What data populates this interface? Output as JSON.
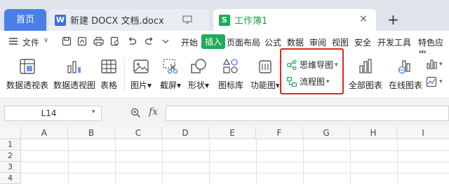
{
  "tabs": {
    "home": "首页",
    "doc": "新建 DOCX 文档.docx",
    "doc_logo": "W",
    "sheet": "工作簿1",
    "sheet_logo": "S",
    "close": "×",
    "new_tab": "+"
  },
  "menu": {
    "file": "文件",
    "file_chev": "∨",
    "items": [
      "开始",
      "插入",
      "页面布局",
      "公式",
      "数据",
      "审阅",
      "视图",
      "安全",
      "开发工具",
      "特色应用"
    ],
    "active_index": 1
  },
  "ribbon": {
    "pivot_table": "数据透视表",
    "pivot_chart": "数据透视图",
    "table": "表格",
    "picture": "图片",
    "screenshot": "截屏",
    "shape": "形状",
    "icon_library": "图标库",
    "function_chart": "功能图",
    "mind_map": "思维导图",
    "flowchart": "流程图",
    "all_charts": "全部图表",
    "online_charts": "在线图表"
  },
  "formula_bar": {
    "cell_ref": "L14",
    "fx": "fx",
    "formula": ""
  },
  "grid": {
    "columns": [
      "A",
      "B",
      "C",
      "D",
      "E",
      "F",
      "G",
      "H",
      "I"
    ],
    "rows": [
      "1",
      "2",
      "3",
      "4"
    ]
  },
  "colors": {
    "accent_green": "#1fab5c",
    "home_blue": "#4a7fe6",
    "highlight_red": "#e02424"
  }
}
